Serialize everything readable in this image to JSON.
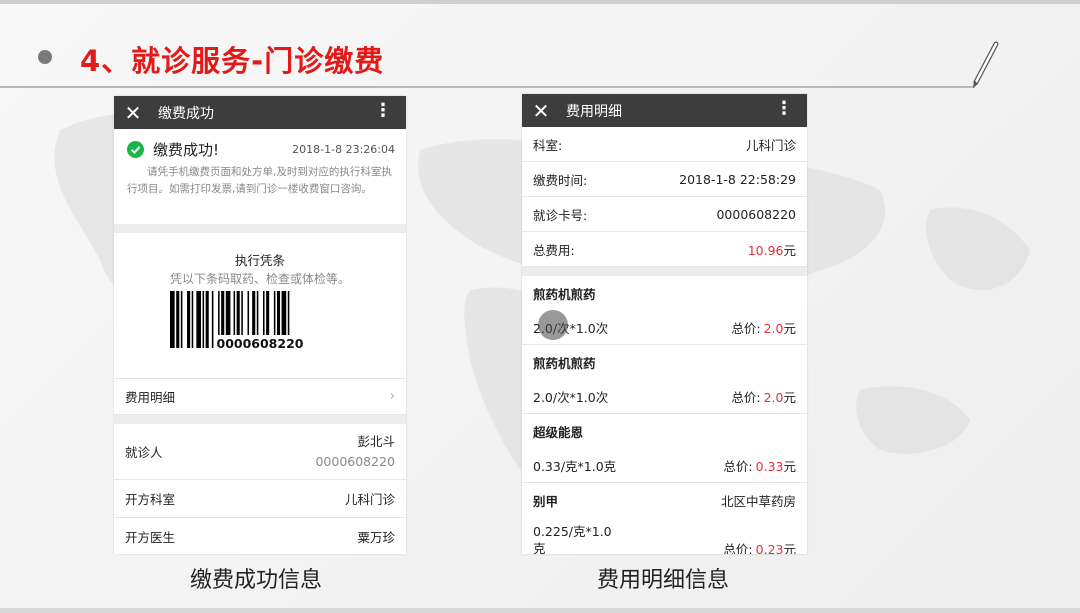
{
  "slide": {
    "title": "4、就诊服务-门诊缴费",
    "caption_left": "缴费成功信息",
    "caption_right": "费用明细信息"
  },
  "left_phone": {
    "close_icon": "close-icon",
    "title": "缴费成功",
    "more_icon": "more-vert-icon",
    "success_label": "缴费成功!",
    "success_time": "2018-1-8 23:26:04",
    "success_note": "请凭手机缴费页面和处方单,及时到对应的执行科室执行项目。如需打印发票,请到门诊一楼收费窗口咨询。",
    "voucher_title": "执行凭条",
    "voucher_sub": "凭以下条码取药、检查或体检等。",
    "barcode_number": "0000608220",
    "fee_detail_label": "费用明细",
    "patient_label": "就诊人",
    "patient_name": "彭北斗",
    "patient_card": "0000608220",
    "dept_label": "开方科室",
    "dept_value": "儿科门诊",
    "doctor_label": "开方医生",
    "doctor_value": "粟万珍"
  },
  "right_phone": {
    "title": "费用明细",
    "info": [
      {
        "label": "科室:",
        "value": "儿科门诊",
        "red": false
      },
      {
        "label": "缴费时间:",
        "value": "2018-1-8 22:58:29",
        "red": false
      },
      {
        "label": "就诊卡号:",
        "value": "0000608220",
        "red": false
      },
      {
        "label": "总费用:",
        "value": "10.96",
        "unit": "元",
        "red": true
      }
    ],
    "items": [
      {
        "name": "煎药机煎药",
        "location": "",
        "qty": "2.0/次*1.0次",
        "total_label": "总价:",
        "total": "2.0",
        "unit": "元"
      },
      {
        "name": "煎药机煎药",
        "location": "",
        "qty": "2.0/次*1.0次",
        "total_label": "总价:",
        "total": "2.0",
        "unit": "元"
      },
      {
        "name": "超级能恩",
        "location": "",
        "qty": "0.33/克*1.0克",
        "total_label": "总价:",
        "total": "0.33",
        "unit": "元"
      },
      {
        "name": "别甲",
        "location": "北区中草药房",
        "qty": "0.225/克*1.0克",
        "total_label": "总价:",
        "total": "0.23",
        "unit": "元"
      }
    ]
  },
  "colors": {
    "title_red": "#e31a1a",
    "price_red": "#e5303c",
    "success_green": "#1db44b",
    "appbar": "#3d3d3d"
  }
}
